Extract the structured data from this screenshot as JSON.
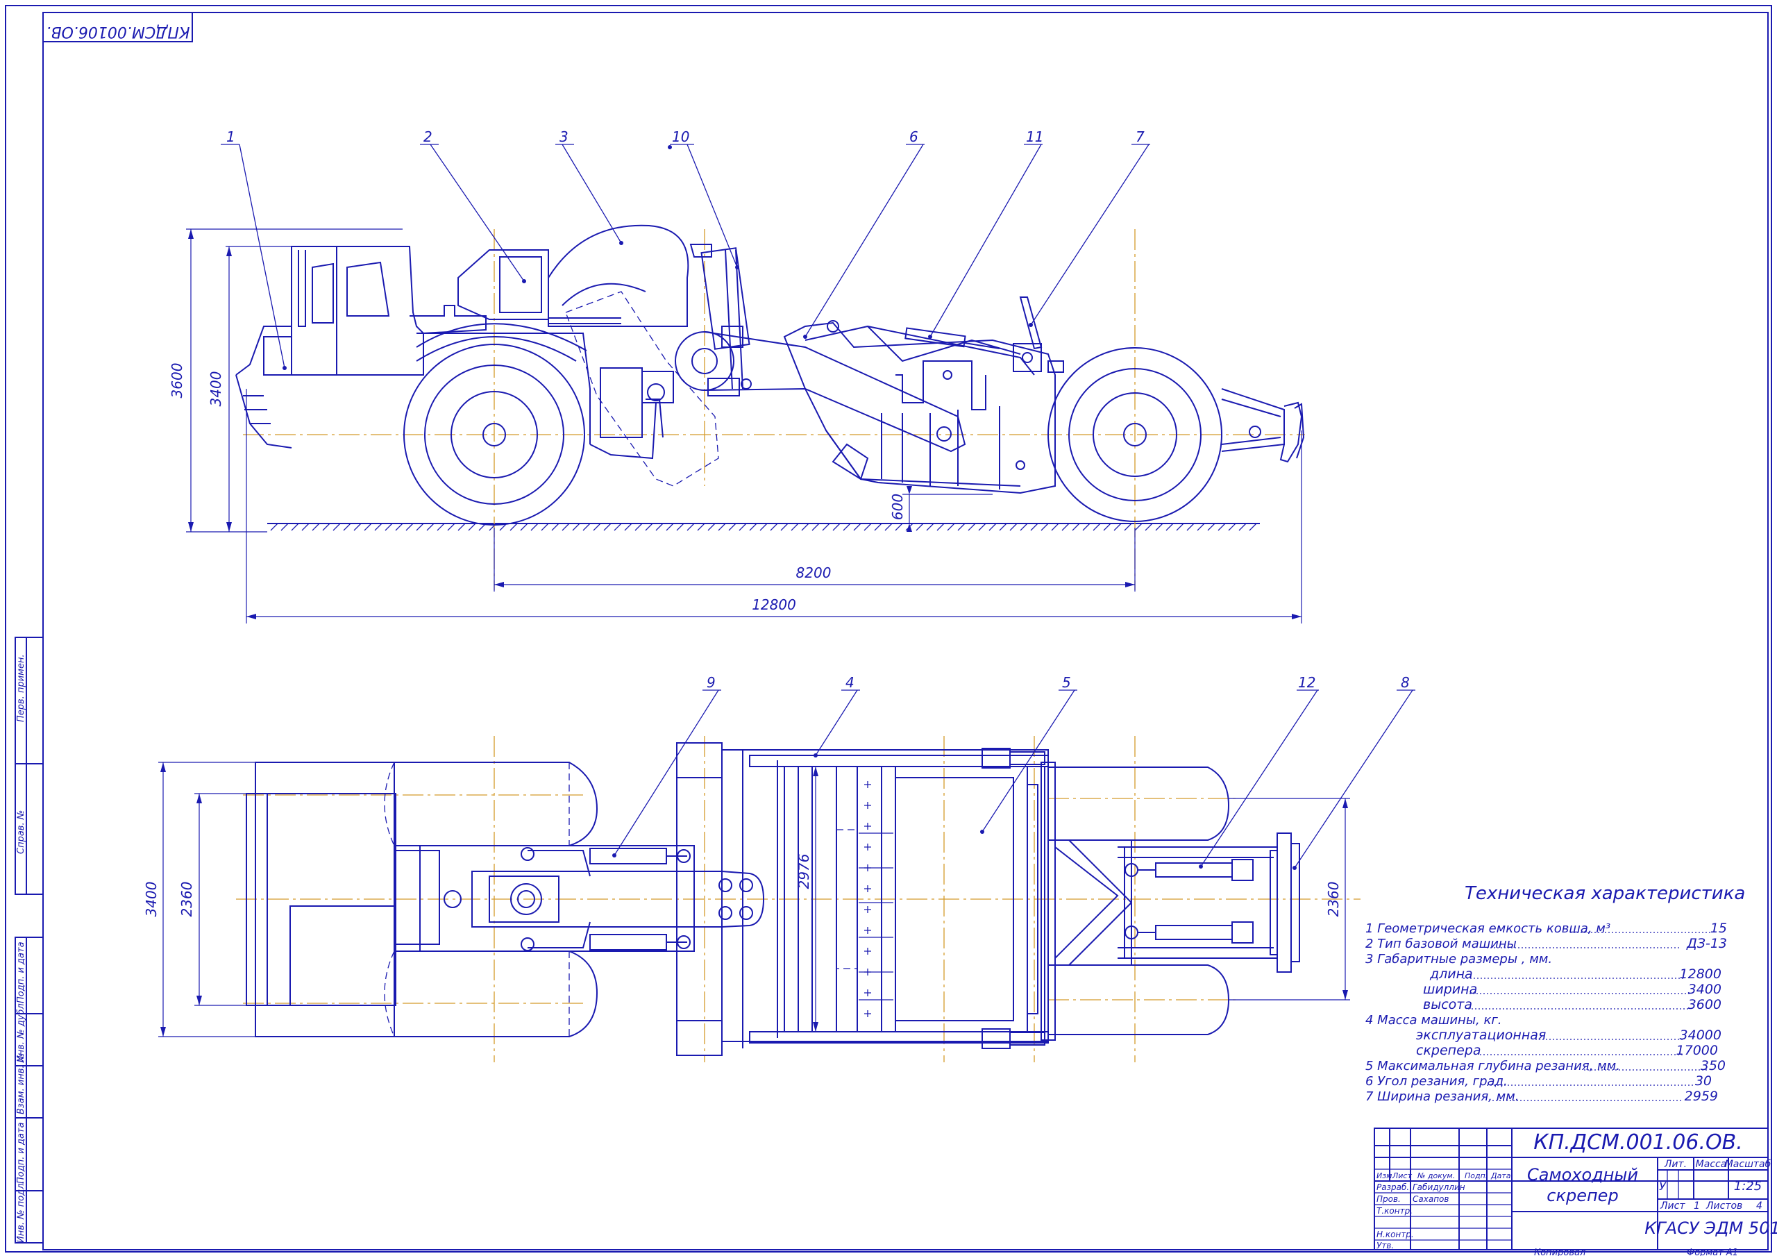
{
  "drawing": {
    "rotated_code": "КПДСМ.00106.ОВ.",
    "callouts": [
      "1",
      "2",
      "3",
      "10",
      "6",
      "11",
      "7",
      "9",
      "4",
      "5",
      "12",
      "8"
    ],
    "side_view": {
      "dim_height_total": "3600",
      "dim_height_cab": "3400",
      "dim_clearance": "600",
      "dim_wheelbase": "8200",
      "dim_length": "12800"
    },
    "top_view": {
      "dim_width": "3400",
      "dim_track_front": "2360",
      "dim_bucket": "2976",
      "dim_track_rear": "2360"
    }
  },
  "specs": {
    "title": "Техническая характеристика",
    "rows": [
      {
        "label": "1 Геометрическая емкость ковша, м³",
        "value": "15"
      },
      {
        "label": "2 Тип базовой машины",
        "value": "ДЗ-13"
      },
      {
        "label": "3 Габаритные размеры , мм.",
        "value": ""
      },
      {
        "label": "длина",
        "value": "12800"
      },
      {
        "label": "ширина",
        "value": "3400"
      },
      {
        "label": "высота",
        "value": "3600"
      },
      {
        "label": "4 Масса машины, кг.",
        "value": ""
      },
      {
        "label": "эксплуатационная",
        "value": "34000"
      },
      {
        "label": "скрепера",
        "value": "17000"
      },
      {
        "label": "5 Максимальная глубина резания, мм.",
        "value": "350"
      },
      {
        "label": "6 Угол резания, град.",
        "value": "30"
      },
      {
        "label": "7 Ширина резания, мм.",
        "value": "2959"
      }
    ]
  },
  "side_stamp": [
    "Перв. примен.",
    "Справ. №",
    "Подп. и дата",
    "Инв. № дубл.",
    "Взам. инв. №",
    "Подп. и дата",
    "Инв. № подл."
  ],
  "title_block": {
    "code": "КП.ДСМ.001.06.ОВ.",
    "name_line1": "Самоходный",
    "name_line2": "скрепер",
    "col_headers": [
      "Изм.",
      "Лист",
      "№ докум.",
      "Подп.",
      "Дата"
    ],
    "roles": [
      "Разраб.",
      "Пров.",
      "Т.контр.",
      "Н.контр.",
      "Утв."
    ],
    "developer": "Габидуллин",
    "checker": "Сахапов",
    "lit_label": "Лит.",
    "mass_label": "Масса",
    "scale_label": "Масштаб",
    "lit_value": "У",
    "scale_value": "1:25",
    "sheet_label": "Лист",
    "sheet_value": "1",
    "sheets_label": "Листов",
    "sheets_value": "4",
    "org": "КГАСУ ЭДМ 501",
    "copied": "Копировал",
    "format": "Формат А1"
  }
}
